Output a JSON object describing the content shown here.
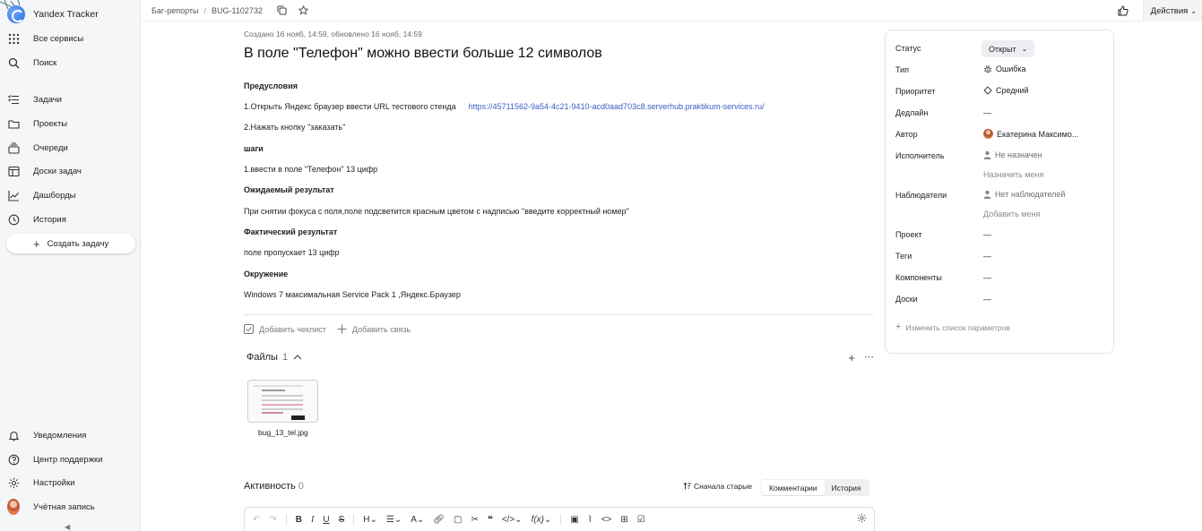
{
  "app": {
    "name": "Yandex Tracker"
  },
  "sidebar": {
    "nav": [
      {
        "label": "Все сервисы",
        "icon": "grid-icon"
      },
      {
        "label": "Поиск",
        "icon": "search-icon"
      },
      {
        "label": "Задачи",
        "icon": "tasks-icon"
      },
      {
        "label": "Проекты",
        "icon": "folder-icon"
      },
      {
        "label": "Очереди",
        "icon": "queue-icon"
      },
      {
        "label": "Доски задач",
        "icon": "board-icon"
      },
      {
        "label": "Дашборды",
        "icon": "chart-icon"
      },
      {
        "label": "История",
        "icon": "history-icon"
      }
    ],
    "create_task": "Создать задачу",
    "bottom": [
      {
        "label": "Уведомления",
        "icon": "bell-icon"
      },
      {
        "label": "Центр поддержки",
        "icon": "help-icon"
      },
      {
        "label": "Настройки",
        "icon": "gear-icon"
      },
      {
        "label": "Учётная запись",
        "icon": "avatar"
      }
    ]
  },
  "topbar": {
    "breadcrumbs": [
      "Баг-репорты",
      "BUG-1102732"
    ],
    "actions_label": "Действия"
  },
  "issue": {
    "meta": "Создано 16 нояб, 14:59, обновлено 16 нояб, 14:59",
    "title": "В поле \"Телефон\" можно ввести больше 12 символов",
    "description": {
      "preconditions_title": "Предусловия",
      "step1_text": "1.Открыть Яндекс браузер ввести URL тестового стенда",
      "step1_link": "https://45711562-9a54-4c21-9410-acd0aad703c8.serverhub.praktikum-services.ru/",
      "step2_text": "2.Нажать кнопку \"заказать\"",
      "steps_title": "шаги",
      "steps_line1": "1.ввести в поле \"Телефон\" 13 цифр",
      "expected_title": "Ожидаемый результат",
      "expected_text": "При снятии фокуса с поля,поле подсветится красным цветом с надписью \"введите корректный номер\"",
      "actual_title": "Фактический результат",
      "actual_text": "поле пропускает 13 цифр",
      "env_title": "Окружение",
      "env_text": "Windows 7 максимальная Service Pack 1 ,Яндекс.Браузер"
    },
    "add_checklist": "Добавить чеклист",
    "add_link": "Добавить связь",
    "files": {
      "title": "Файлы",
      "count": "1",
      "items": [
        {
          "name": "bug_13_tel.jpg"
        }
      ]
    },
    "activity": {
      "title": "Активность",
      "count": "0",
      "sort_label": "Сначала старые",
      "tabs": [
        "Комментарии",
        "История"
      ]
    }
  },
  "properties": {
    "status_label": "Статус",
    "status_value": "Открыт",
    "type_label": "Тип",
    "type_value": "Ошибка",
    "priority_label": "Приоритет",
    "priority_value": "Средний",
    "deadline_label": "Дедлайн",
    "deadline_value": "—",
    "author_label": "Автор",
    "author_value": "Екатерина Максимо...",
    "assignee_label": "Исполнитель",
    "assignee_value": "Не назначен",
    "assign_me": "Назначить меня",
    "watchers_label": "Наблюдатели",
    "watchers_value": "Нет наблюдателей",
    "add_me": "Добавить меня",
    "project_label": "Проект",
    "project_value": "—",
    "tags_label": "Теги",
    "tags_value": "—",
    "components_label": "Компоненты",
    "components_value": "—",
    "boards_label": "Доски",
    "boards_value": "—",
    "edit_params": "Изменить список параметров"
  },
  "colors": {
    "accent_link": "#3d5cc4",
    "sidebar_bg": "#f5f6f8",
    "status_pill_bg": "#eceef2"
  }
}
